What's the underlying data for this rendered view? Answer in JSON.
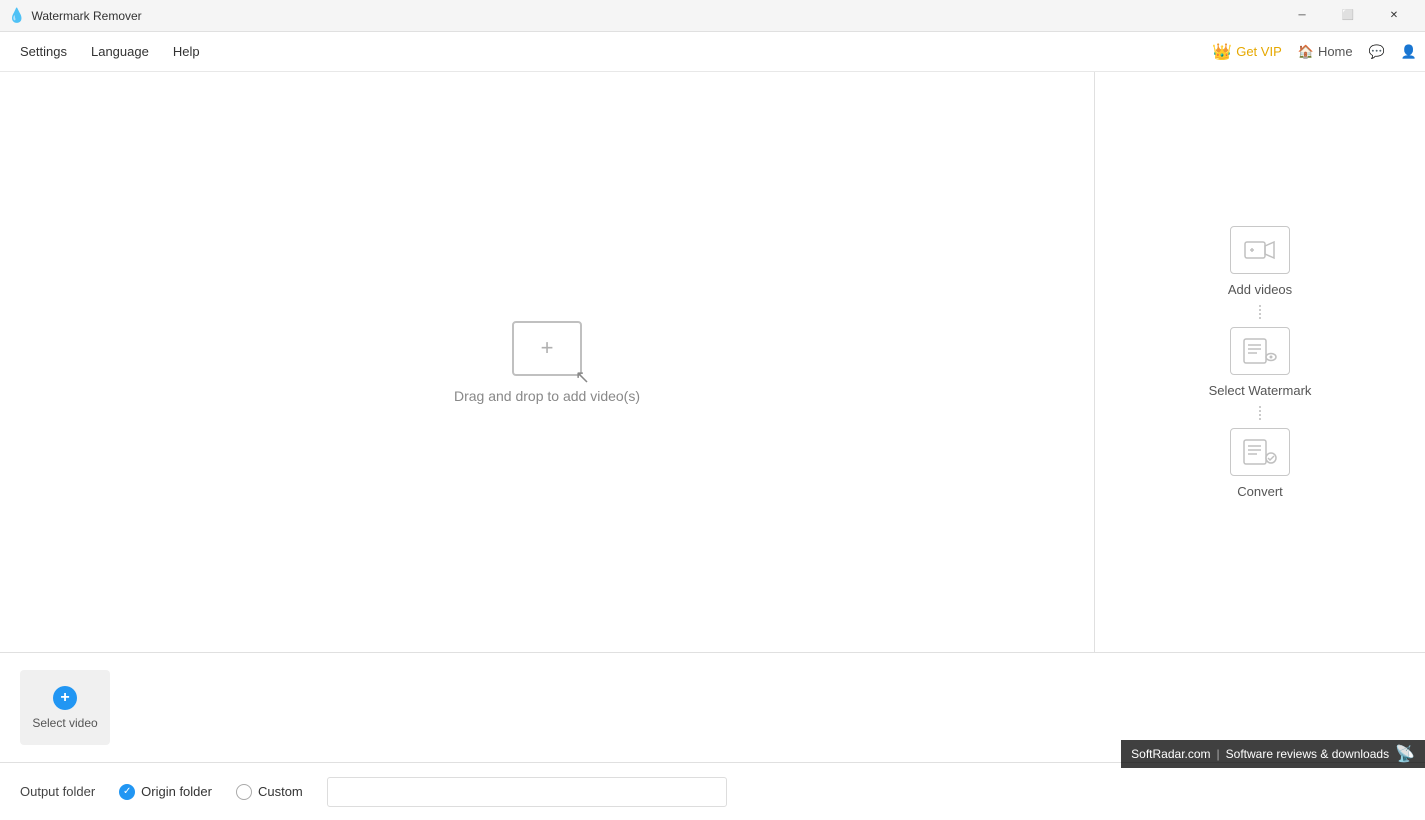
{
  "titlebar": {
    "title": "Watermark Remover",
    "minimize_label": "─",
    "restore_label": "⬜",
    "close_label": "✕"
  },
  "menubar": {
    "items": [
      "Settings",
      "Language",
      "Help"
    ],
    "vip_label": "Get VIP",
    "home_label": "Home"
  },
  "main": {
    "drop_label": "Drag and drop to add video(s)"
  },
  "sidebar": {
    "steps": [
      {
        "label": "Add videos",
        "type": "add"
      },
      {
        "label": "Select Watermark",
        "type": "select"
      },
      {
        "label": "Convert",
        "type": "convert"
      }
    ]
  },
  "bottom": {
    "select_label": "Select video"
  },
  "output_bar": {
    "label": "Output folder",
    "origin_label": "Origin folder",
    "custom_label": "Custom",
    "custom_placeholder": ""
  },
  "softradar": {
    "line1": "SoftRadar.com",
    "line2": "Software reviews & downloads"
  }
}
